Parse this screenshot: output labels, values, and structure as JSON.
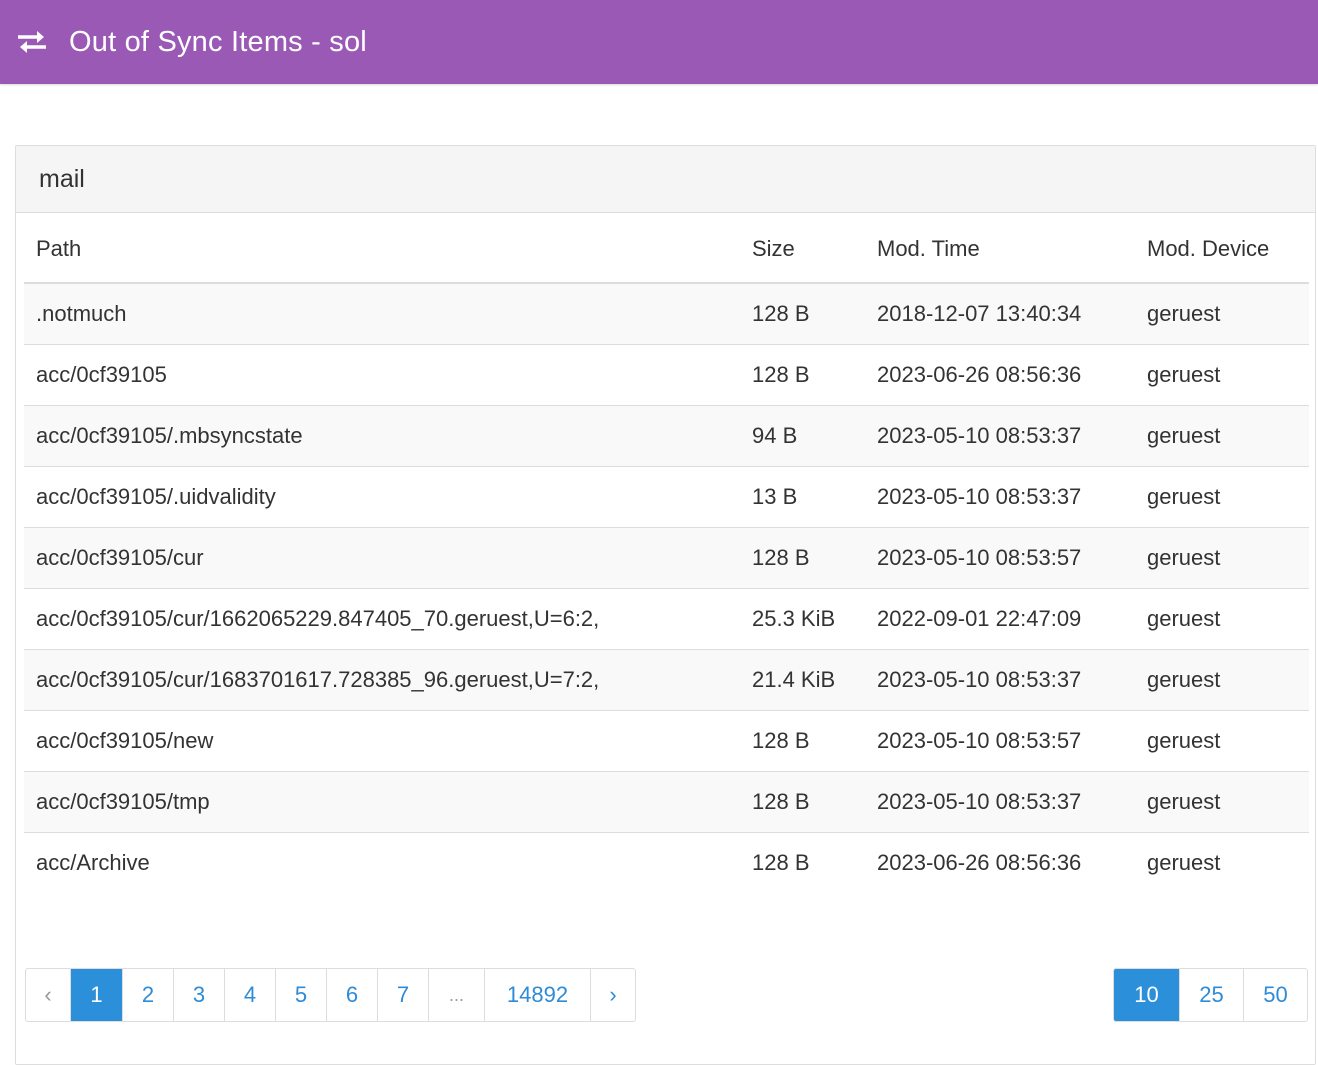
{
  "header": {
    "title": "Out of Sync Items - sol",
    "icon": "exchange-icon",
    "color": "#9b59b6"
  },
  "panel": {
    "heading": "mail"
  },
  "table": {
    "columns": [
      "Path",
      "Size",
      "Mod. Time",
      "Mod. Device"
    ],
    "rows": [
      {
        "path": ".notmuch",
        "size": "128 B",
        "time": "2018-12-07 13:40:34",
        "device": "geruest"
      },
      {
        "path": "acc/0cf39105",
        "size": "128 B",
        "time": "2023-06-26 08:56:36",
        "device": "geruest"
      },
      {
        "path": "acc/0cf39105/.mbsyncstate",
        "size": "94 B",
        "time": "2023-05-10 08:53:37",
        "device": "geruest"
      },
      {
        "path": "acc/0cf39105/.uidvalidity",
        "size": "13 B",
        "time": "2023-05-10 08:53:37",
        "device": "geruest"
      },
      {
        "path": "acc/0cf39105/cur",
        "size": "128 B",
        "time": "2023-05-10 08:53:57",
        "device": "geruest"
      },
      {
        "path": "acc/0cf39105/cur/1662065229.847405_70.geruest,U=6:2,",
        "size": "25.3 KiB",
        "time": "2022-09-01 22:47:09",
        "device": "geruest"
      },
      {
        "path": "acc/0cf39105/cur/1683701617.728385_96.geruest,U=7:2,",
        "size": "21.4 KiB",
        "time": "2023-05-10 08:53:37",
        "device": "geruest"
      },
      {
        "path": "acc/0cf39105/new",
        "size": "128 B",
        "time": "2023-05-10 08:53:57",
        "device": "geruest"
      },
      {
        "path": "acc/0cf39105/tmp",
        "size": "128 B",
        "time": "2023-05-10 08:53:37",
        "device": "geruest"
      },
      {
        "path": "acc/Archive",
        "size": "128 B",
        "time": "2023-06-26 08:56:36",
        "device": "geruest"
      }
    ]
  },
  "pagination": {
    "prev": "‹",
    "pages": [
      "1",
      "2",
      "3",
      "4",
      "5",
      "6",
      "7",
      "...",
      "14892"
    ],
    "active_page": "1",
    "next": "›"
  },
  "page_size": {
    "options": [
      "10",
      "25",
      "50"
    ],
    "active": "10"
  },
  "colors": {
    "accent": "#2b8fd9",
    "link": "#2e8bd8"
  }
}
